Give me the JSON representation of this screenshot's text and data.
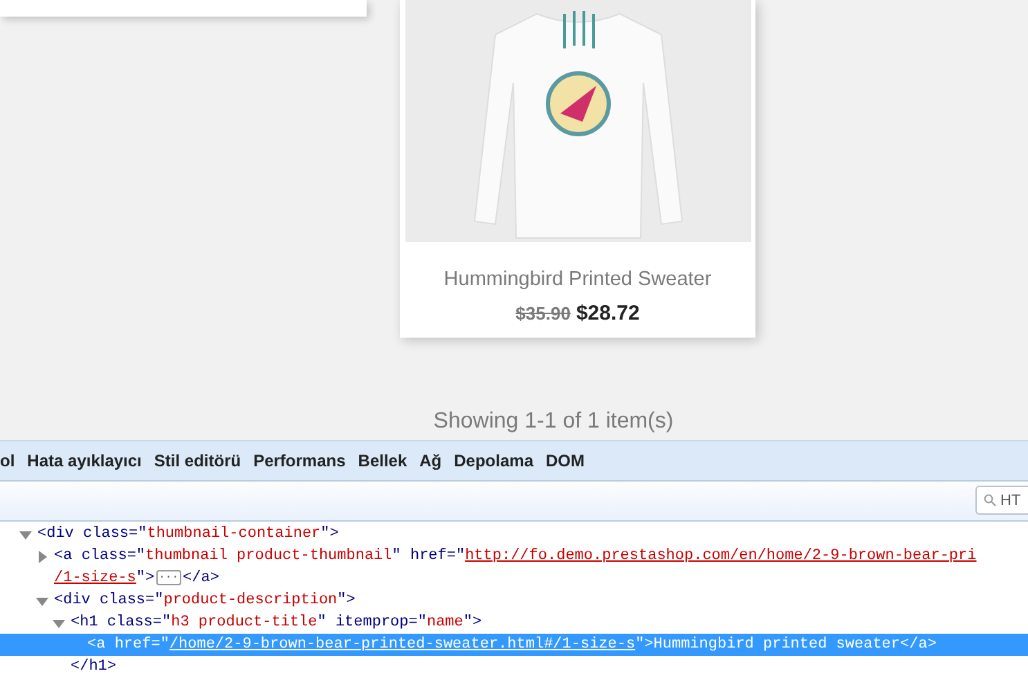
{
  "product": {
    "title": "Hummingbird Printed Sweater",
    "old_price": "$35.90",
    "price": "$28.72"
  },
  "pagination": {
    "summary": "Showing 1-1 of 1 item(s)"
  },
  "devtools": {
    "tabs": [
      {
        "label": "ol",
        "selected": false
      },
      {
        "label": "Hata ayıklayıcı",
        "selected": false
      },
      {
        "label": "Stil editörü",
        "selected": false
      },
      {
        "label": "Performans",
        "selected": false
      },
      {
        "label": "Bellek",
        "selected": false
      },
      {
        "label": "Ağ",
        "selected": false
      },
      {
        "label": "Depolama",
        "selected": false
      },
      {
        "label": "DOM",
        "selected": false
      }
    ],
    "search": {
      "placeholder": "HT"
    },
    "tree": [
      {
        "expanded": true,
        "selected": false,
        "lines": [
          [
            {
              "kind": "markup",
              "text": "<div "
            },
            {
              "kind": "attr",
              "text": "class"
            },
            {
              "kind": "markup",
              "text": "=\""
            },
            {
              "kind": "value",
              "text": "thumbnail-container"
            },
            {
              "kind": "markup",
              "text": "\">"
            }
          ]
        ],
        "children": [
          {
            "expanded": false,
            "selected": false,
            "lines": [
              [
                {
                  "kind": "markup",
                  "text": "<a "
                },
                {
                  "kind": "attr",
                  "text": "class"
                },
                {
                  "kind": "markup",
                  "text": "=\""
                },
                {
                  "kind": "value",
                  "text": "thumbnail product-thumbnail"
                },
                {
                  "kind": "markup",
                  "text": "\" "
                },
                {
                  "kind": "attr",
                  "text": "href"
                },
                {
                  "kind": "markup",
                  "text": "=\""
                },
                {
                  "kind": "link",
                  "text": "http://fo.demo.prestashop.com/en/home/2-9-brown-bear-pri"
                }
              ],
              [
                {
                  "kind": "link",
                  "text": "/1-size-s"
                },
                {
                  "kind": "markup",
                  "text": "\">"
                },
                {
                  "kind": "ellipsis",
                  "text": "···"
                },
                {
                  "kind": "markup",
                  "text": "</a>"
                }
              ]
            ]
          },
          {
            "expanded": true,
            "selected": false,
            "lines": [
              [
                {
                  "kind": "markup",
                  "text": "<div "
                },
                {
                  "kind": "attr",
                  "text": "class"
                },
                {
                  "kind": "markup",
                  "text": "=\""
                },
                {
                  "kind": "value",
                  "text": "product-description"
                },
                {
                  "kind": "markup",
                  "text": "\">"
                }
              ]
            ],
            "children": [
              {
                "expanded": true,
                "selected": false,
                "closing": "</h1>",
                "lines": [
                  [
                    {
                      "kind": "markup",
                      "text": "<h1 "
                    },
                    {
                      "kind": "attr",
                      "text": "class"
                    },
                    {
                      "kind": "markup",
                      "text": "=\""
                    },
                    {
                      "kind": "value",
                      "text": "h3 product-title"
                    },
                    {
                      "kind": "markup",
                      "text": "\" "
                    },
                    {
                      "kind": "attr",
                      "text": "itemprop"
                    },
                    {
                      "kind": "markup",
                      "text": "=\""
                    },
                    {
                      "kind": "value",
                      "text": "name"
                    },
                    {
                      "kind": "markup",
                      "text": "\">"
                    }
                  ]
                ],
                "children": [
                  {
                    "expanded": false,
                    "selected": true,
                    "lines": [
                      [
                        {
                          "kind": "markup",
                          "text": "<a "
                        },
                        {
                          "kind": "attr",
                          "text": "href"
                        },
                        {
                          "kind": "markup",
                          "text": "=\""
                        },
                        {
                          "kind": "link",
                          "text": "/home/2-9-brown-bear-printed-sweater.html#/1-size-s"
                        },
                        {
                          "kind": "markup",
                          "text": "\">"
                        },
                        {
                          "kind": "text",
                          "text": "Hummingbird printed sweater"
                        },
                        {
                          "kind": "markup",
                          "text": "</a>"
                        }
                      ]
                    ]
                  }
                ]
              }
            ]
          }
        ]
      }
    ]
  }
}
